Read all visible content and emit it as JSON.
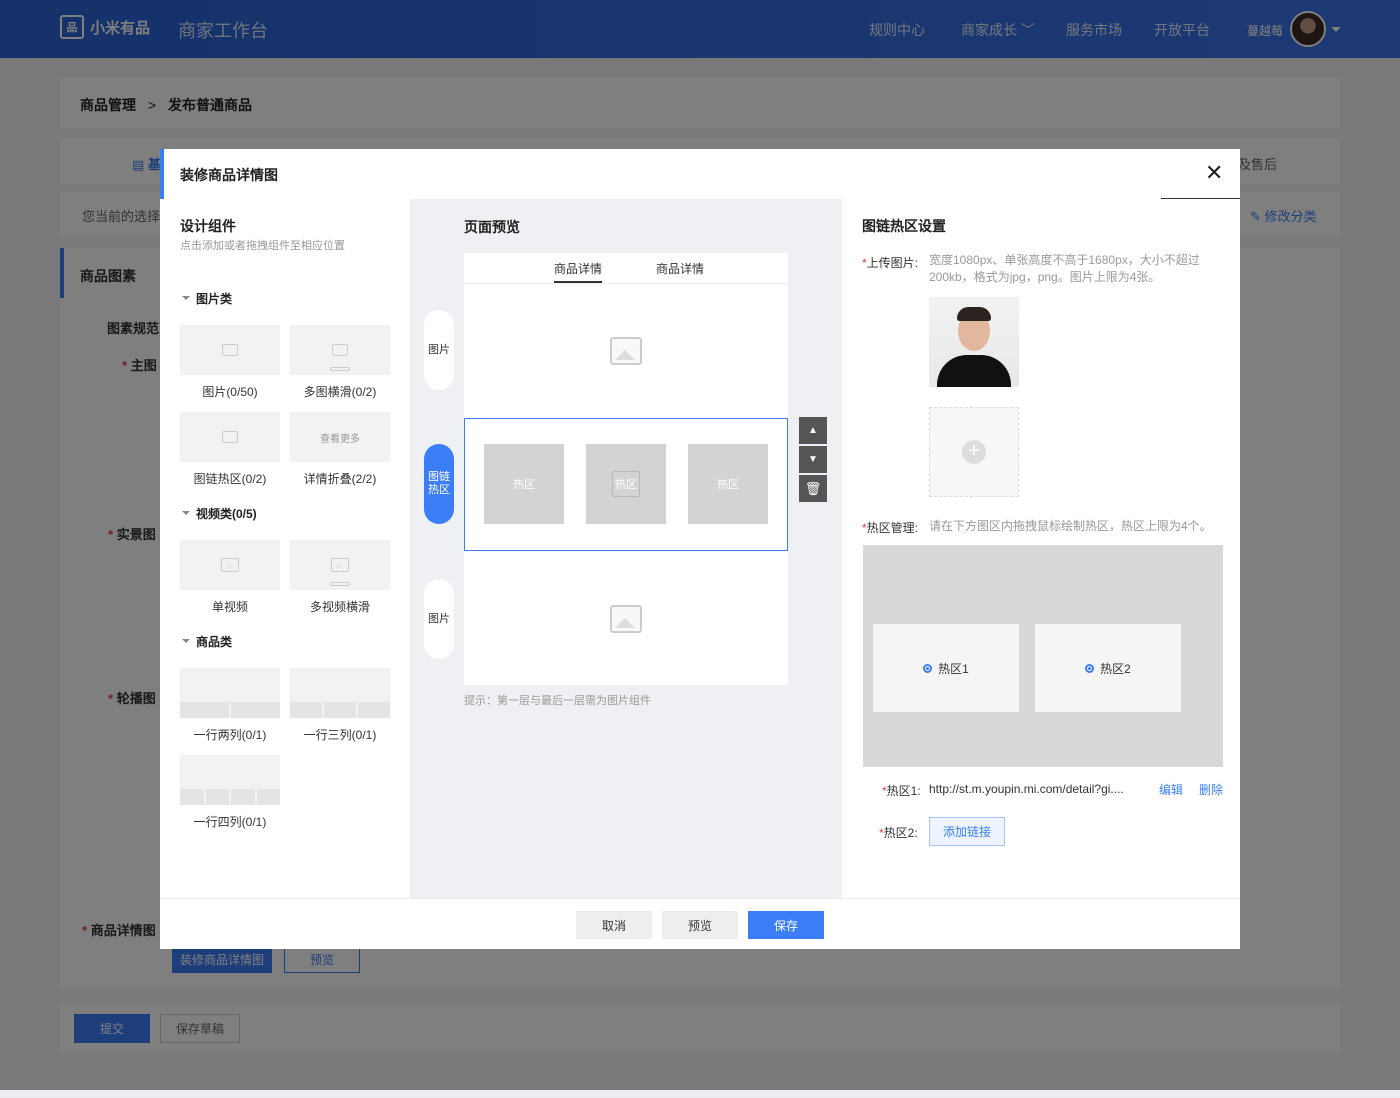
{
  "header": {
    "brand": "小米有品",
    "app_title": "商家工作台",
    "nav": [
      "规则中心",
      "商家成长",
      "服务市场",
      "开放平台"
    ],
    "user_name": "蔓越莓"
  },
  "background": {
    "breadcrumb_root": "商品管理",
    "breadcrumb_current": "发布普通商品",
    "tab_basic": "基",
    "tab_aftersale": "及售后",
    "current_selection": "您当前的选择",
    "modify_category": "修改分类",
    "section_title": "商品图素",
    "spec": "图素规范",
    "main_image": "主图",
    "real_image": "实景图",
    "carousel": "轮播图",
    "detail_image": "商品详情图",
    "decorate_button": "装修商品详情图",
    "preview_button": "预览",
    "submit": "提交",
    "save_draft": "保存草稿"
  },
  "modal": {
    "title": "装修商品详情图",
    "left": {
      "title": "设计组件",
      "subtitle": "点击添加或者拖拽组件至相应位置",
      "categories": [
        {
          "name": "图片类",
          "items": [
            "图片(0/50)",
            "多图横滑(0/2)",
            "图链热区(0/2)",
            "详情折叠(2/2)"
          ]
        },
        {
          "name": "视频类(0/5)",
          "items": [
            "单视频",
            "多视频横滑"
          ]
        },
        {
          "name": "商品类",
          "items": [
            "一行两列(0/1)",
            "一行三列(0/1)",
            "一行四列(0/1)"
          ]
        }
      ],
      "fold_thumb_text": "查看更多"
    },
    "middle": {
      "title": "页面预览",
      "tabs": [
        "商品详情",
        "商品详情"
      ],
      "side_tabs": [
        "图片",
        "图链热区",
        "图片"
      ],
      "hotzone_label": "热区",
      "hint": "提示：第一层与最后一层需为图片组件"
    },
    "right": {
      "title": "图链热区设置",
      "upload_label": "上传图片:",
      "upload_desc_1": "宽度1080px、单张高度不高于1680px，大小不超过",
      "upload_desc_2": "200kb，格式为jpg，png。图片上限为4张。",
      "hz_label": "热区管理:",
      "hz_desc": "请在下方图区内拖拽鼠标绘制热区，热区上限为4个。",
      "zones": [
        "热区1",
        "热区2"
      ],
      "zone1_label": "热区1:",
      "zone1_url": "http://st.m.youpin.mi.com/detail?gi....",
      "edit": "编辑",
      "delete": "删除",
      "zone2_label": "热区2:",
      "add_link": "添加链接"
    },
    "footer": {
      "cancel": "取消",
      "preview": "预览",
      "save": "保存"
    }
  },
  "colors": {
    "accent": "#3b7df5",
    "header": "#2b63d6",
    "required": "#e94040"
  }
}
